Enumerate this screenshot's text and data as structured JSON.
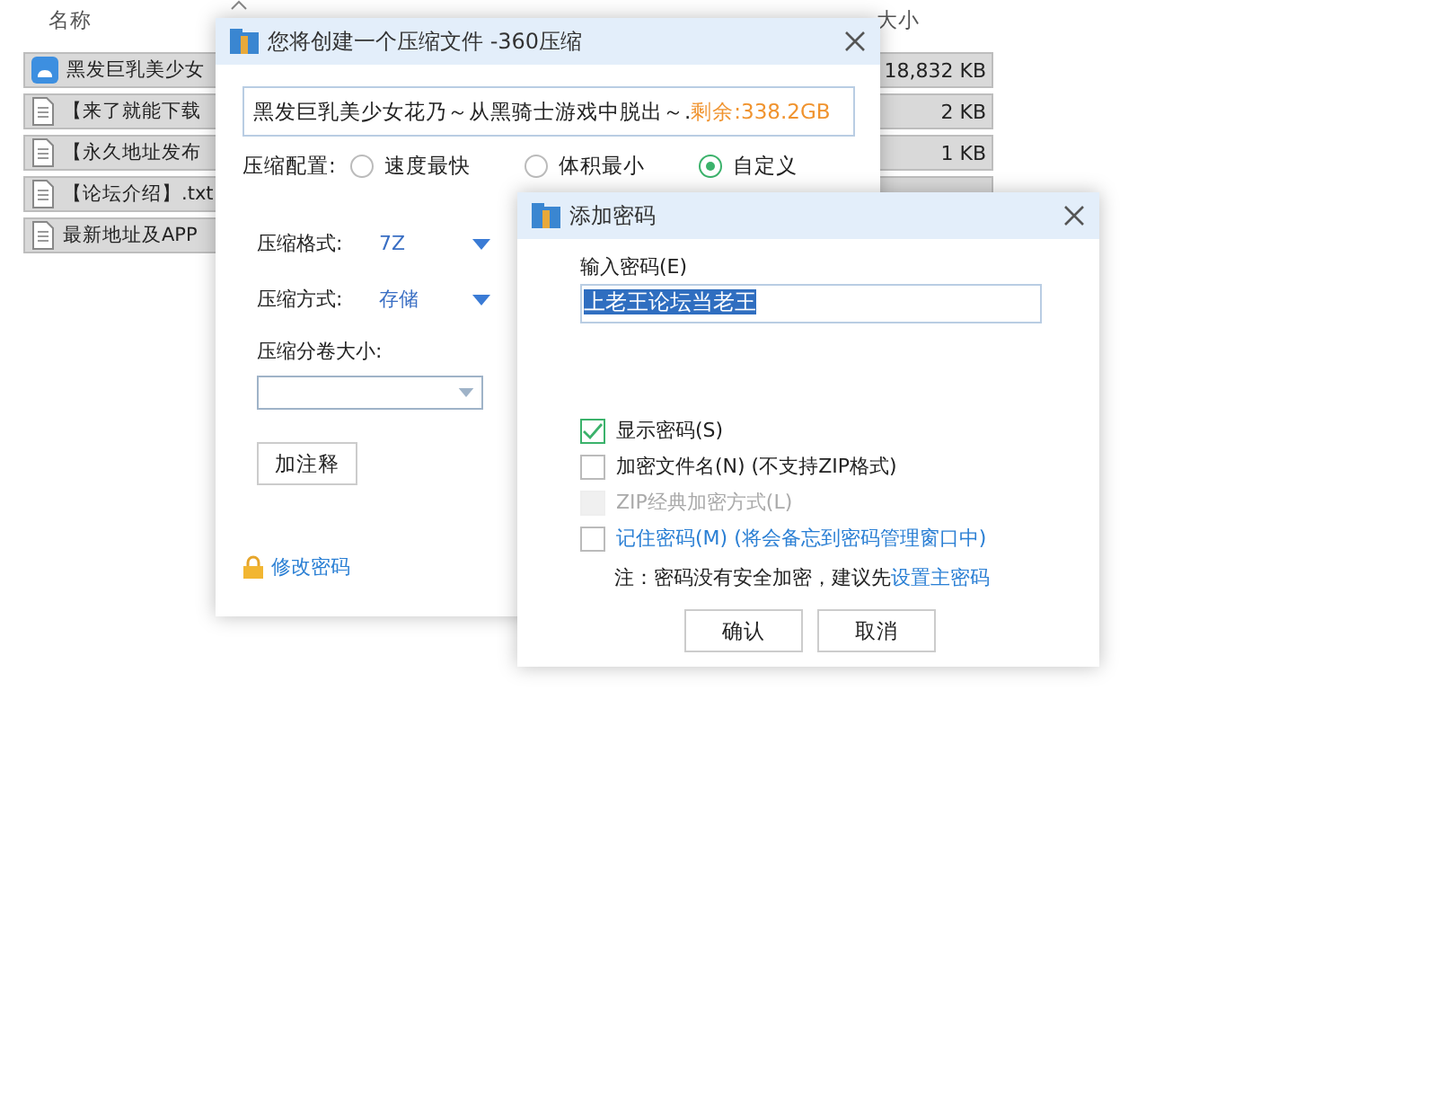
{
  "file_list": {
    "columns": [
      {
        "label": "名称",
        "kind": "name"
      },
      {
        "label": "大小",
        "kind": "size"
      }
    ],
    "rows": [
      {
        "name": "黑发巨乳美少女",
        "size": "18,832 KB",
        "kind": "app",
        "selected": true
      },
      {
        "name": "【来了就能下载",
        "size": "2 KB",
        "kind": "text",
        "selected": true
      },
      {
        "name": "【永久地址发布",
        "size": "1 KB",
        "kind": "text",
        "selected": true
      },
      {
        "name": "【论坛介绍】.txt",
        "kind": "text",
        "selected": true
      },
      {
        "name": "最新地址及APP",
        "kind": "text",
        "selected": true
      }
    ]
  },
  "compress_dialog": {
    "title": "您将创建一个压缩文件 -360压缩",
    "path": "黑发巨乳美少女花乃～从黑骑士游戏中脱出～.",
    "free_space": "剩余:338.2GB",
    "config_label": "压缩配置:",
    "config_options": [
      {
        "label": "速度最快",
        "selected": false
      },
      {
        "label": "体积最小",
        "selected": false
      },
      {
        "label": "自定义",
        "selected": true
      }
    ],
    "format_label": "压缩格式:",
    "format": "7Z",
    "method_label": "压缩方式:",
    "method": "存储",
    "volume_label": "压缩分卷大小:",
    "comment_button": "加注释",
    "change_password_link": "修改密码"
  },
  "password_dialog": {
    "title": "添加密码",
    "input_label": "输入密码(E)",
    "password": "上老王论坛当老王",
    "options": [
      {
        "label": "显示密码(S)",
        "checked": true,
        "disabled": false,
        "link": false
      },
      {
        "label": "加密文件名(N) (不支持ZIP格式)",
        "checked": false,
        "disabled": false,
        "link": false
      },
      {
        "label": "ZIP经典加密方式(L)",
        "checked": false,
        "disabled": true,
        "link": false
      },
      {
        "label": "记住密码(M) (将会备忘到密码管理窗口中)",
        "checked": false,
        "disabled": false,
        "link": true
      }
    ],
    "note": "注：密码没有安全加密，建议先",
    "note_link": "设置主密码",
    "buttons": [
      "确认",
      "取消"
    ]
  }
}
